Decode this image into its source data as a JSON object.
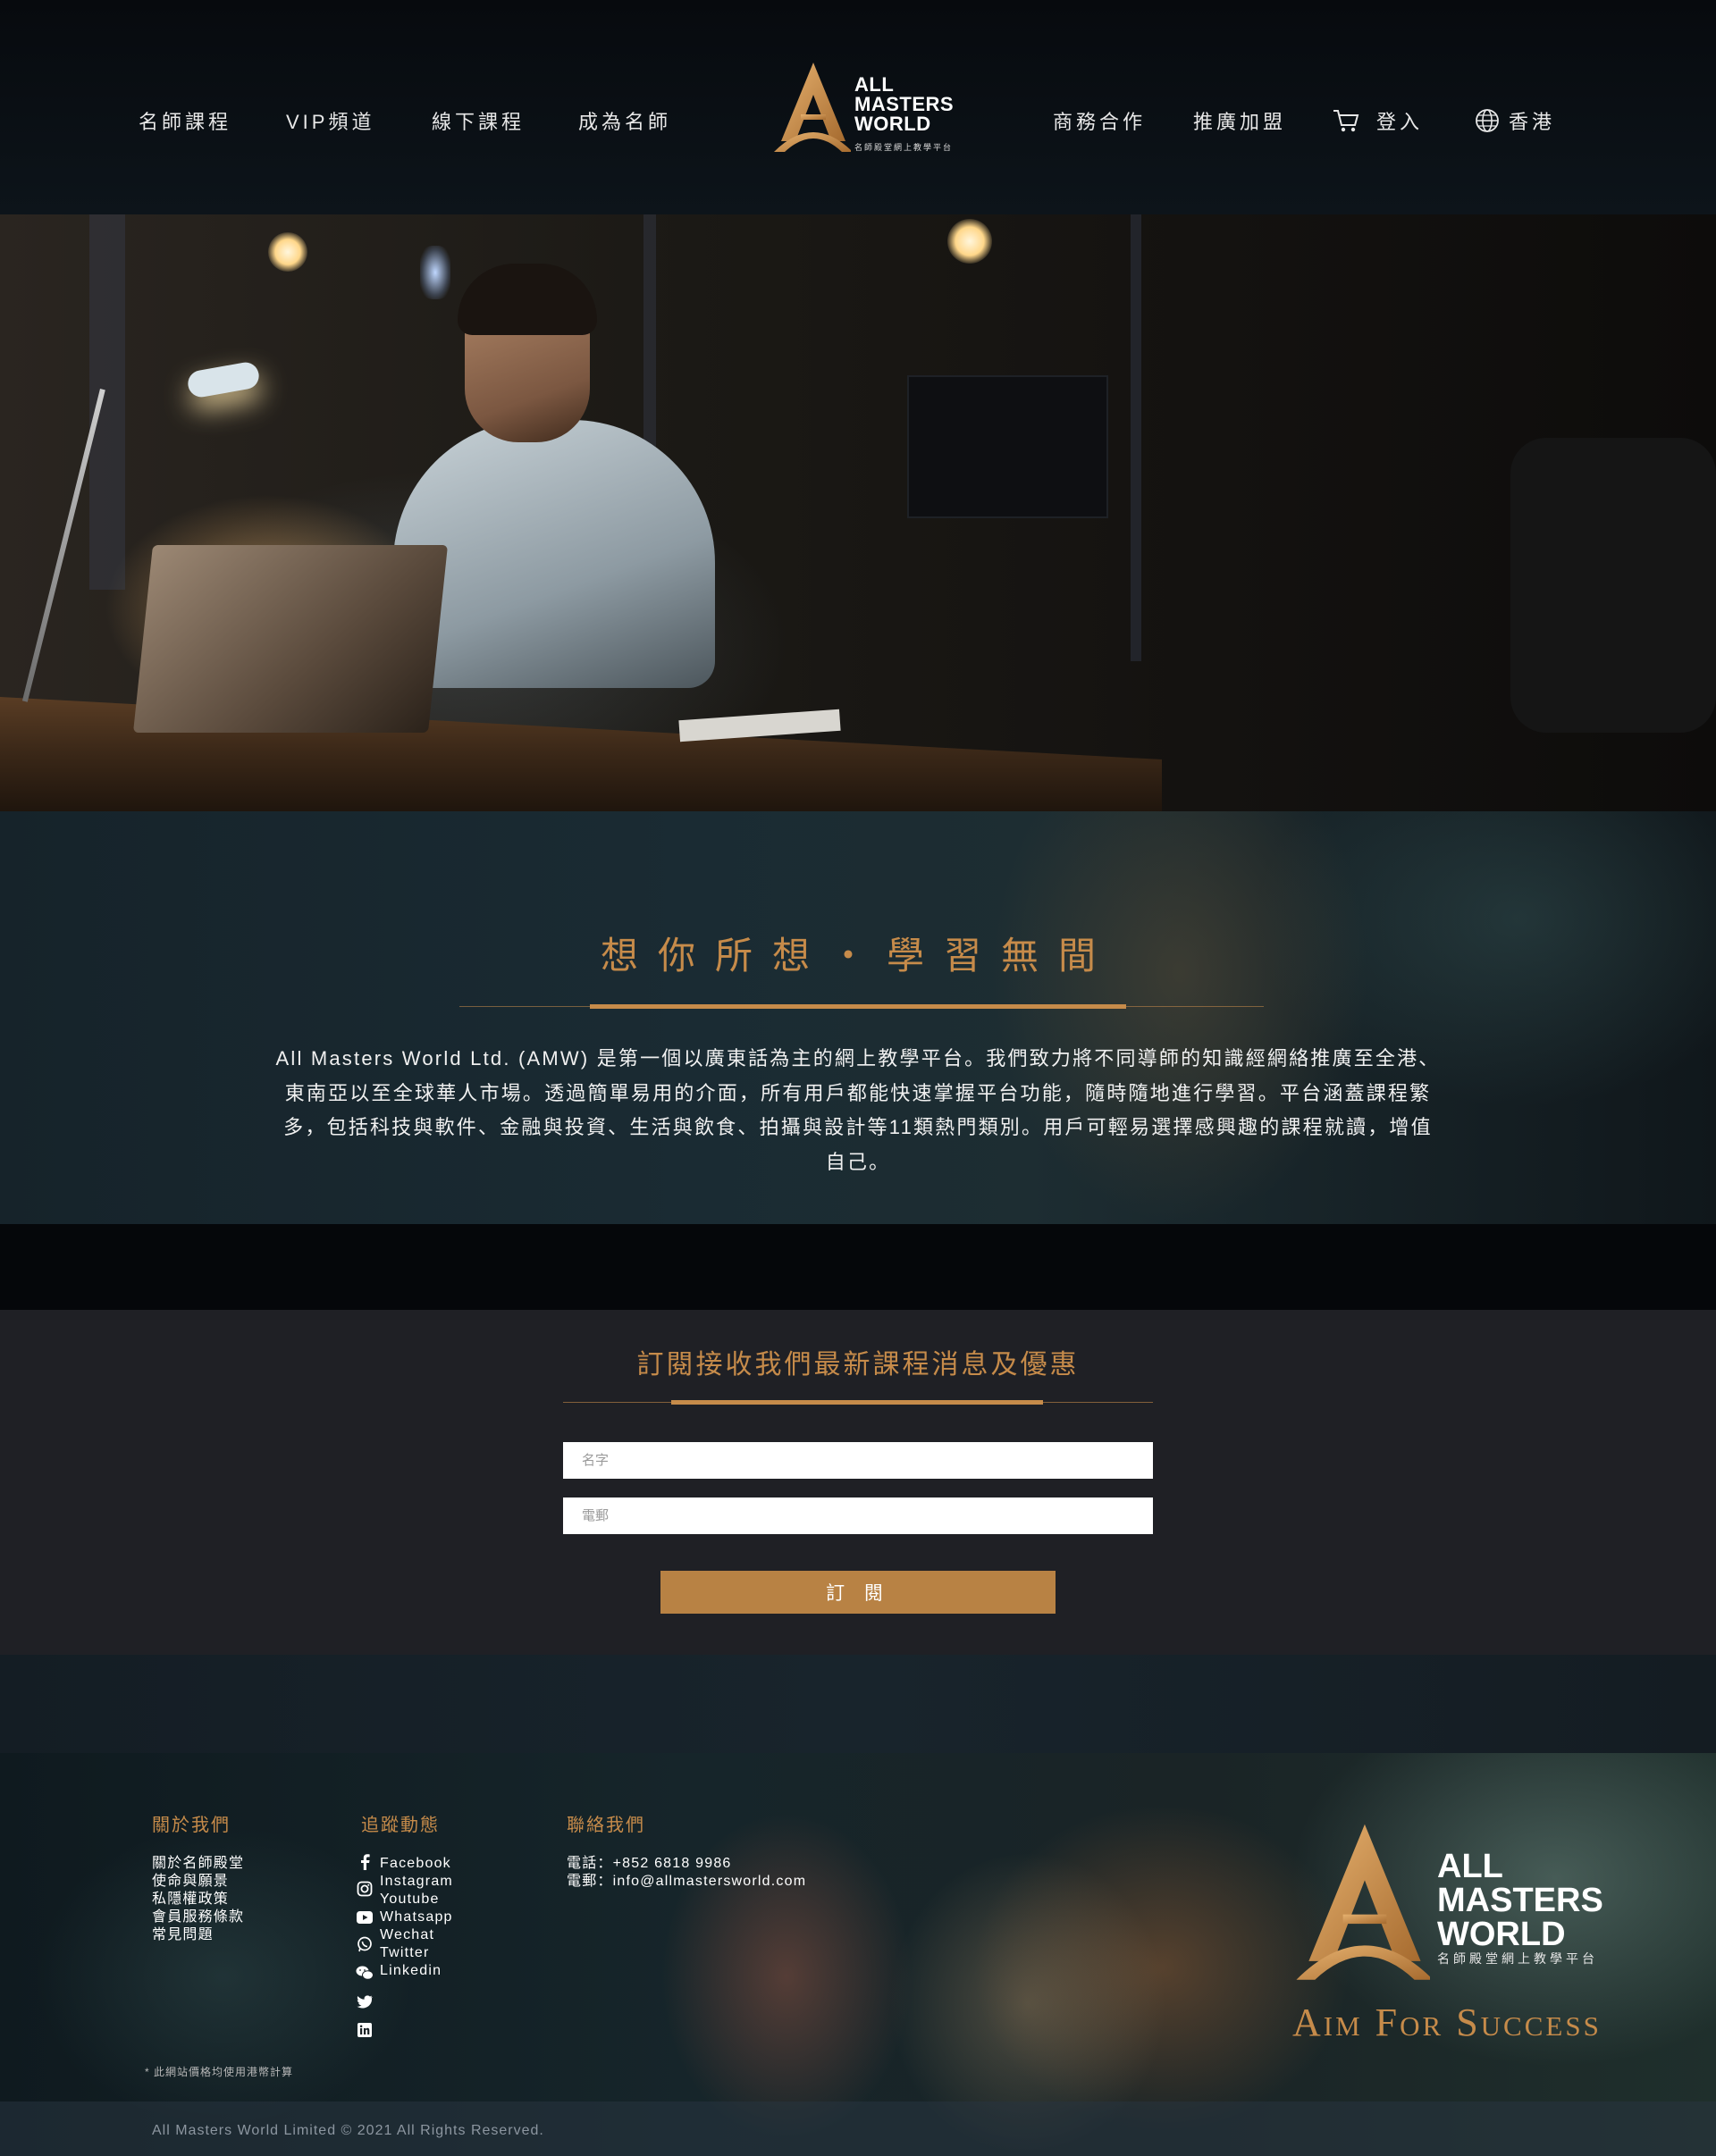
{
  "nav": {
    "left": [
      "名師課程",
      "VIP頻道",
      "線下課程",
      "成為名師"
    ],
    "right": [
      "商務合作",
      "推廣加盟"
    ],
    "login": "登入",
    "region": "香港"
  },
  "logo": {
    "line1": "ALL",
    "line2": "MASTERS",
    "line3": "WORLD",
    "tagline": "名師殿堂網上教學平台"
  },
  "about": {
    "title": "想你所想・學習無間",
    "body": "All Masters World Ltd. (AMW) 是第一個以廣東話為主的網上教學平台。我們致力將不同導師的知識經網絡推廣至全港、東南亞以至全球華人市場。透過簡單易用的介面，所有用戶都能快速掌握平台功能，隨時隨地進行學習。平台涵蓋課程繁多，包括科技與軟件、金融與投資、生活與飲食、拍攝與設計等11類熱門類別。用戶可輕易選擇感興趣的課程就讀，增值自己。"
  },
  "subscribe": {
    "title": "訂閱接收我們最新課程消息及優惠",
    "name_placeholder": "名字",
    "email_placeholder": "電郵",
    "button": "訂 閱"
  },
  "footer": {
    "about_heading": "關於我們",
    "about_links": [
      "關於名師殿堂",
      "使命與願景",
      "私隱權政策",
      "會員服務條款",
      "常見問題"
    ],
    "social_heading": "追蹤動態",
    "social_links": [
      "Facebook",
      "Instagram",
      "Youtube",
      "Whatsapp",
      "Wechat",
      "Twitter",
      "Linkedin"
    ],
    "social_icons": [
      "facebook-icon",
      "instagram-icon",
      "youtube-icon",
      "whatsapp-icon",
      "wechat-icon",
      "twitter-icon",
      "linkedin-icon"
    ],
    "contact_heading": "聯絡我們",
    "phone": "電話：+852 6818 9986",
    "email": "電郵：info@allmastersworld.com",
    "note": "* 此網站價格均使用港幣計算",
    "copyright": "All Masters World Limited © 2021 All Rights Reserved.",
    "slogan": "Aim For Success"
  },
  "colors": {
    "accent": "#c68b4a",
    "button": "#b88244",
    "header_bg": "#070a0e",
    "subscribe_bg": "#1f2025"
  }
}
